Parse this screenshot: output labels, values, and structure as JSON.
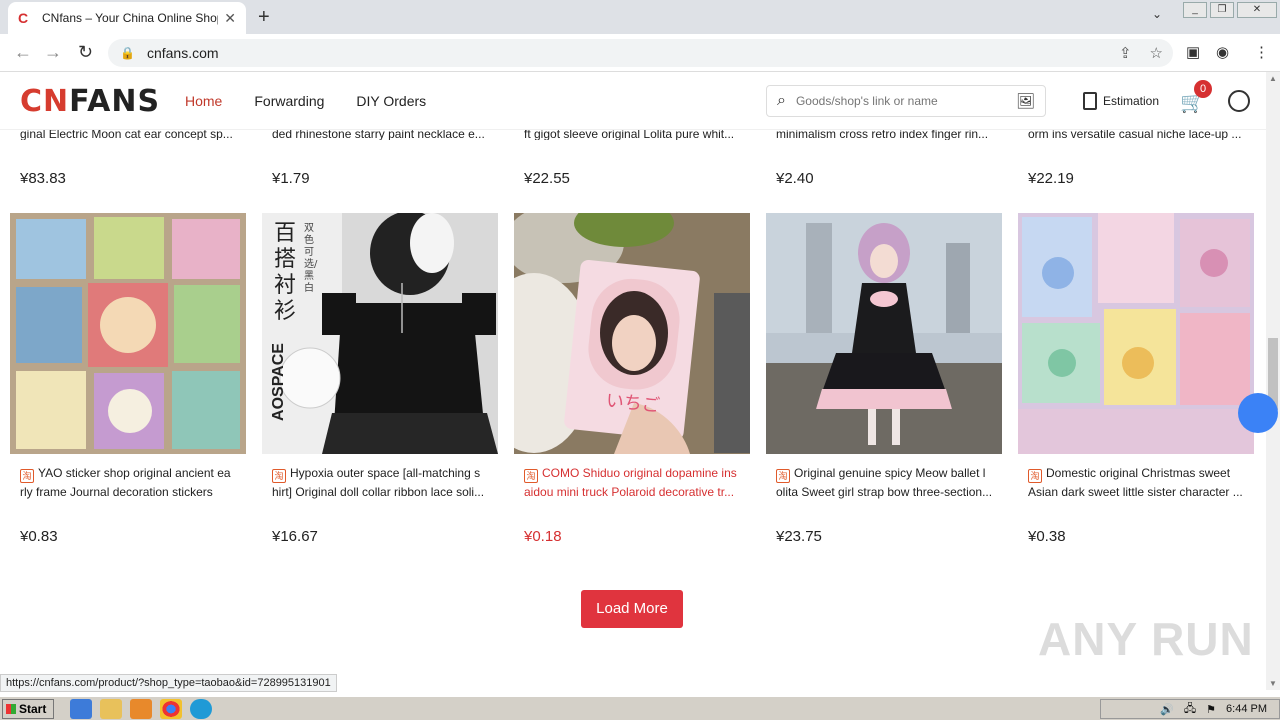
{
  "browser": {
    "tab_title": "CNfans – Your China Online Shopping",
    "url": "cnfans.com",
    "new_tab": "+",
    "tab_close": "✕",
    "nav_back": "←",
    "nav_forward": "→",
    "reload": "↻",
    "status_url": "https://cnfans.com/product/?shop_type=taobao&id=728995131901"
  },
  "site": {
    "logo_red": "CN",
    "logo_black": "FANS",
    "menu": {
      "home": "Home",
      "forwarding": "Forwarding",
      "diy": "DIY Orders"
    },
    "search_placeholder": "Goods/shop's link or name",
    "estimation": "Estimation",
    "cart_count": "0"
  },
  "previous_row": [
    {
      "title": "ginal Electric Moon cat ear concept sp...",
      "price": "¥83.83"
    },
    {
      "title": "ded rhinestone starry paint necklace e...",
      "price": "¥1.79"
    },
    {
      "title": "ft gigot sleeve original Lolita pure whit...",
      "price": "¥22.55"
    },
    {
      "title": "minimalism cross retro index finger rin...",
      "price": "¥2.40"
    },
    {
      "title": "orm ins versatile casual niche lace-up ...",
      "price": "¥22.19"
    }
  ],
  "products": [
    {
      "title": "YAO sticker shop original ancient ea rly frame Journal decoration stickers",
      "price": "¥0.83"
    },
    {
      "title": "Hypoxia outer space [all-matching s hirt] Original doll collar ribbon lace soli...",
      "price": "¥16.67"
    },
    {
      "title": "COMO Shiduo original dopamine ins aidou mini truck Polaroid decorative tr...",
      "price": "¥0.18"
    },
    {
      "title": "Original genuine spicy Meow ballet l olita Sweet girl strap bow three-section...",
      "price": "¥23.75"
    },
    {
      "title": "Domestic original Christmas sweet Asian dark sweet little sister character ...",
      "price": "¥0.38"
    }
  ],
  "thumb_text": {
    "vertical_cn": "百搭衬衫",
    "side_cn": "双色可选/黑白",
    "aospace": "AOSPACE",
    "card_cn": "いちご"
  },
  "load_more": "Load More",
  "watermark": "ANY RUN",
  "taskbar": {
    "start": "Start",
    "time": "6:44 PM"
  },
  "colors": {
    "accent": "#e0343e",
    "brand_red": "#d63c2f"
  }
}
